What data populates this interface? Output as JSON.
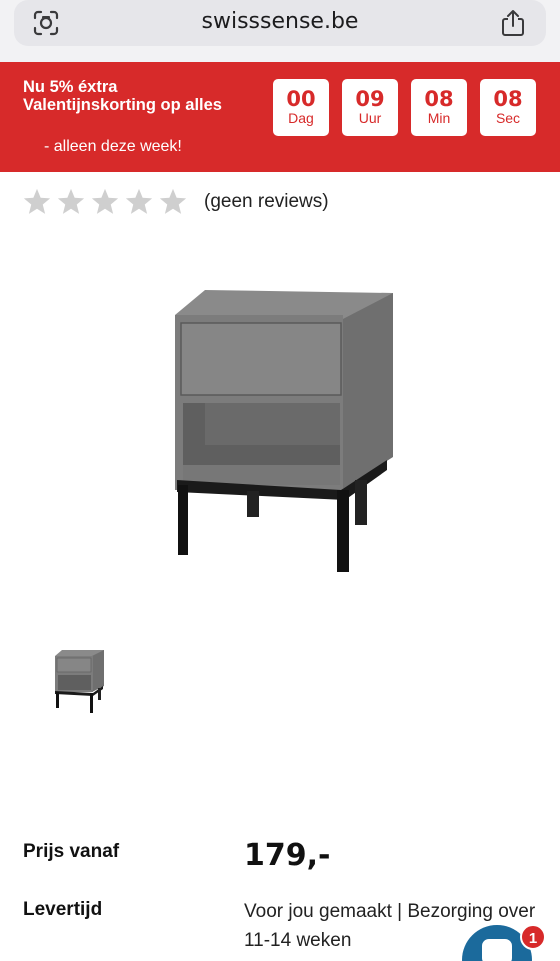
{
  "browser": {
    "url": "swisssense.be"
  },
  "promo": {
    "title": "Nu 5% éxtra Valentijnskorting op alles",
    "subtitle": "- alleen deze week!",
    "countdown": [
      {
        "value": "00",
        "unit": "Dag"
      },
      {
        "value": "09",
        "unit": "Uur"
      },
      {
        "value": "08",
        "unit": "Min"
      },
      {
        "value": "08",
        "unit": "Sec"
      }
    ],
    "background_color": "#d72a2a"
  },
  "rating": {
    "stars_filled": 0,
    "stars_total": 5,
    "reviews_label": "(geen reviews)"
  },
  "product": {
    "price_label": "Prijs vanaf",
    "price": "179,-",
    "delivery_label": "Levertijd",
    "delivery_text": "Voor jou gemaakt | Bezorging over 11-14 weken"
  },
  "chat": {
    "badge_count": "1",
    "color": "#1b6a9c"
  }
}
